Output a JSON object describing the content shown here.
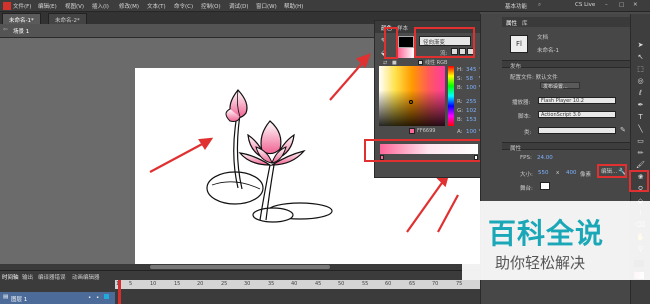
{
  "menubar": {
    "items": [
      "文件(F)",
      "编辑(E)",
      "视图(V)",
      "插入(I)",
      "修改(M)",
      "文本(T)",
      "命令(C)",
      "控制(O)",
      "调试(D)",
      "窗口(W)",
      "帮助(H)"
    ],
    "workspace": "基本功能",
    "cslive": "CS Live"
  },
  "tabs": [
    "未命名-1*",
    "未命名-2*"
  ],
  "scene": "场景 1",
  "color_panel": {
    "tabs": [
      "颜色",
      "样本"
    ],
    "type_label": "径向渐变",
    "overflow_label": "流:",
    "linear_rgb": "线性 RGB",
    "hsb": [
      {
        "k": "H:",
        "v": "345",
        "u": "°"
      },
      {
        "k": "S:",
        "v": "58",
        "u": "%"
      },
      {
        "k": "B:",
        "v": "100",
        "u": "%"
      }
    ],
    "rgb": [
      {
        "k": "R:",
        "v": "255"
      },
      {
        "k": "G:",
        "v": "102"
      },
      {
        "k": "B:",
        "v": "153"
      }
    ],
    "alpha": {
      "k": "A:",
      "v": "100",
      "u": "%"
    },
    "hex": "FF6699",
    "icon_names": [
      "pencil-icon",
      "paint-bucket-icon",
      "swap-colors-icon",
      "default-colors-icon"
    ]
  },
  "properties": {
    "tabs": [
      "属性",
      "库"
    ],
    "doc_icon": "Fl",
    "doc_type": "文档",
    "doc_name": "未命名-1",
    "publish_section": "发布",
    "config_label": "配置文件: 默认文件",
    "publish_settings_btn": "发布设置...",
    "player_label": "播放器:",
    "player_value": "Flash Player 10.2",
    "script_label": "脚本:",
    "script_value": "ActionScript 3.0",
    "class_label": "类:",
    "class_value": "",
    "props_section": "属性",
    "fps_label": "FPS:",
    "fps_value": "24.00",
    "size_label": "大小:",
    "width": "550",
    "x_sep": "x",
    "height": "400",
    "size_unit": "像素",
    "edit_btn": "编辑...",
    "stage_label": "舞台:"
  },
  "timeline": {
    "tabs": [
      "时间轴",
      "输出",
      "编译器错误",
      "动画编辑器"
    ],
    "layer_name": "图层 1",
    "frames": [
      "1",
      "5",
      "10",
      "15",
      "20",
      "25",
      "30",
      "35",
      "40",
      "45",
      "50",
      "55",
      "60",
      "65",
      "70",
      "75"
    ]
  },
  "watermark": {
    "title": "百科全说",
    "subtitle": "助你轻松解决"
  },
  "colors": {
    "accent_red": "#e03030",
    "selected_pink": "#ff6699",
    "watermark_teal": "#1aa8b8"
  }
}
